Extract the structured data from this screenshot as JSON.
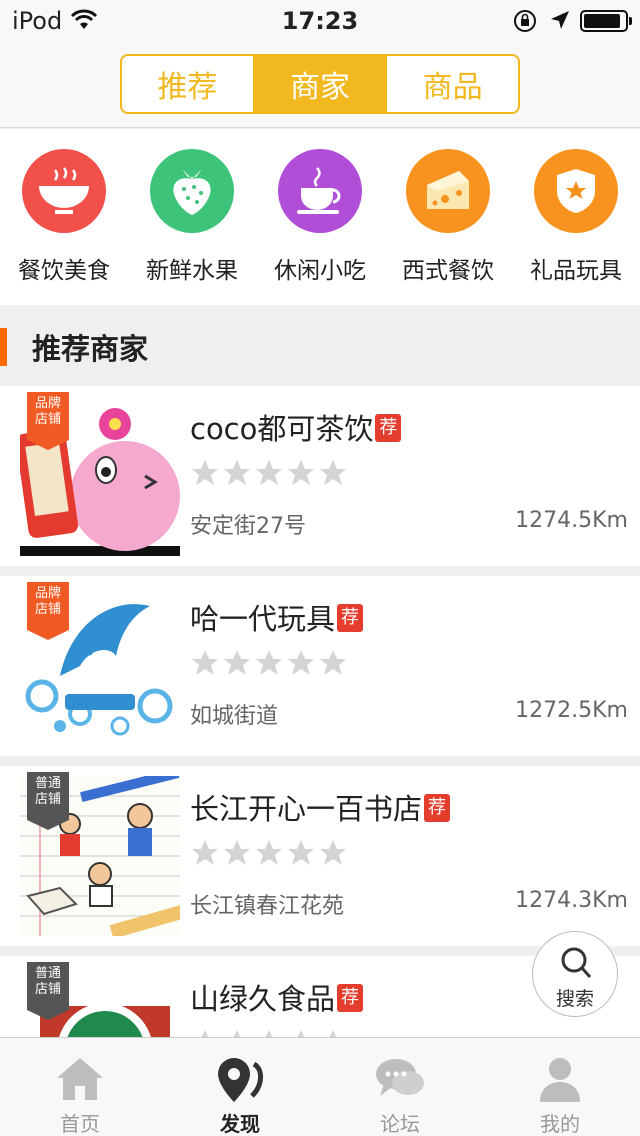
{
  "status_bar": {
    "carrier": "iPod",
    "time": "17:23"
  },
  "segments": [
    {
      "label": "推荐",
      "active": false
    },
    {
      "label": "商家",
      "active": true
    },
    {
      "label": "商品",
      "active": false
    }
  ],
  "categories": [
    {
      "label": "餐饮美食",
      "icon": "bowl-icon",
      "color": "#f2504a"
    },
    {
      "label": "新鲜水果",
      "icon": "strawberry-icon",
      "color": "#3ec47a"
    },
    {
      "label": "休闲小吃",
      "icon": "coffee-cup-icon",
      "color": "#b04ed8"
    },
    {
      "label": "西式餐饮",
      "icon": "cheese-icon",
      "color": "#f7931e"
    },
    {
      "label": "礼品玩具",
      "icon": "gift-badge-icon",
      "color": "#f7931e"
    }
  ],
  "section": {
    "title": "推荐商家"
  },
  "shops": [
    {
      "name": "coco都可茶饮",
      "rec": "荐",
      "tag": "品牌\n店铺",
      "tag_type": "brand",
      "address": "安定街27号",
      "distance": "1274.5Km"
    },
    {
      "name": "哈一代玩具",
      "rec": "荐",
      "tag": "品牌\n店铺",
      "tag_type": "brand",
      "address": "如城街道",
      "distance": "1272.5Km"
    },
    {
      "name": "长江开心一百书店",
      "rec": "荐",
      "tag": "普通\n店铺",
      "tag_type": "normal",
      "address": "长江镇春江花苑",
      "distance": "1274.3Km"
    },
    {
      "name": "山绿久食品",
      "rec": "荐",
      "tag": "普通\n店铺",
      "tag_type": "normal",
      "address": "",
      "distance": ""
    }
  ],
  "fab": {
    "label": "搜索"
  },
  "tabs": [
    {
      "label": "首页",
      "icon": "home-icon",
      "active": false
    },
    {
      "label": "发现",
      "icon": "discover-pin-icon",
      "active": true
    },
    {
      "label": "论坛",
      "icon": "chat-bubbles-icon",
      "active": false
    },
    {
      "label": "我的",
      "icon": "user-icon",
      "active": false
    }
  ],
  "colors": {
    "accent": "#f2b820",
    "brand_tag": "#f25a24",
    "rec_badge": "#e43d2e",
    "section_bar": "#ff6a00"
  }
}
